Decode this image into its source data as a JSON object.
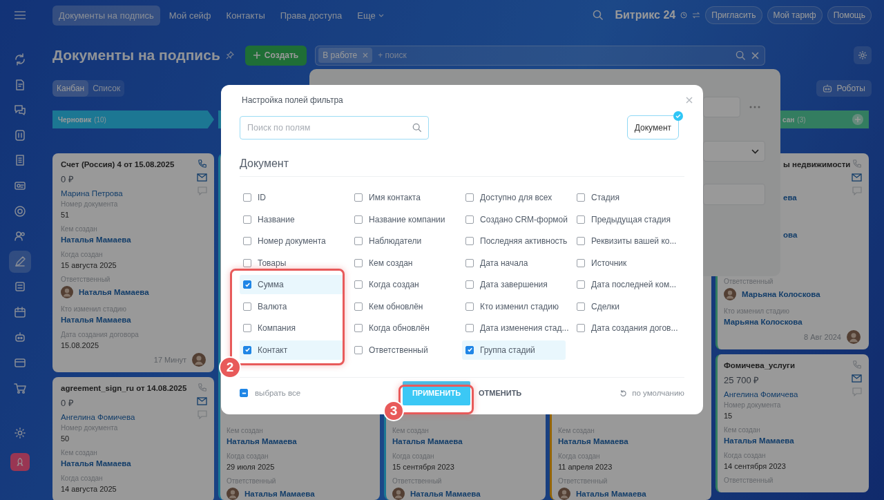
{
  "sidebar": {
    "items": [
      {
        "selected": false
      },
      {
        "selected": false
      },
      {
        "selected": false
      },
      {
        "selected": false
      },
      {
        "selected": false
      },
      {
        "selected": false
      },
      {
        "selected": false
      },
      {
        "selected": false
      },
      {
        "selected": true
      },
      {
        "selected": false
      },
      {
        "selected": false
      },
      {
        "selected": false
      },
      {
        "selected": false
      },
      {
        "selected": false
      }
    ]
  },
  "top_nav": {
    "tabs": [
      {
        "label": "Документы на подпись",
        "selected": true
      },
      {
        "label": "Мой сейф",
        "selected": false
      },
      {
        "label": "Контакты",
        "selected": false
      },
      {
        "label": "Права доступа",
        "selected": false
      },
      {
        "label": "Еще",
        "selected": false
      }
    ],
    "logo": "Битрикс 24",
    "buttons": [
      "Пригласить",
      "Мой тариф",
      "Помощь"
    ]
  },
  "header": {
    "title": "Документы на подпись",
    "create_button": "Создать",
    "filter": {
      "tag": "В работе",
      "placeholder": "+ поиск"
    }
  },
  "view_switch": [
    {
      "label": "Канбан",
      "selected": true
    },
    {
      "label": "Список",
      "selected": false
    }
  ],
  "robots_button": "Роботы",
  "columns": [
    {
      "title": "Черновик",
      "count": "(10)",
      "cut": false,
      "cards": [
        {
          "title": "Счет (Россия) 4 от 15.08.2025",
          "amount": "0 ₽",
          "client": "Марина Петрова",
          "phone_active": true,
          "fields": [
            {
              "label": "Номер документа",
              "value": "51",
              "kind": "text"
            },
            {
              "label": "Кем создан",
              "value": "Наталья Мамаева",
              "kind": "link"
            },
            {
              "label": "Когда создан",
              "value": "15 августа 2025",
              "kind": "text"
            },
            {
              "label": "Ответственный",
              "value": "Наталья Мамаева",
              "kind": "person"
            },
            {
              "label": "Кто изменил стадию",
              "value": "Наталья Мамаева",
              "kind": "link"
            },
            {
              "label": "Дата создания договора",
              "value": "15.08.2025",
              "kind": "text"
            }
          ],
          "time": "17 Минут"
        },
        {
          "title": "agreement_sign_ru от 14.08.2025",
          "amount": "0 ₽",
          "client": "Ангелина Фомичева",
          "phone_active": false,
          "fields": [
            {
              "label": "Номер документа",
              "value": "50",
              "kind": "text"
            },
            {
              "label": "Кем создан",
              "value": "Наталья Мамаева",
              "kind": "link"
            },
            {
              "label": "Когда создан",
              "value": "14 августа 2025",
              "kind": "text"
            }
          ]
        }
      ]
    },
    {
      "cards": [
        {
          "fields": [
            {
              "label": "Кем создан",
              "value": "Наталья Мамаева",
              "kind": "link"
            },
            {
              "label": "Когда создан",
              "value": "29 июля 2025",
              "kind": "text"
            },
            {
              "label": "Ответственный",
              "value": "Наталья Мамаева",
              "kind": "person"
            }
          ]
        }
      ]
    },
    {
      "cards": [
        {
          "fields": [
            {
              "label": "Кем создан",
              "value": "Наталья Мамаева",
              "kind": "link"
            },
            {
              "label": "Когда создан",
              "value": "15 сентября 2023",
              "kind": "text"
            },
            {
              "label": "Ответственный",
              "value": "Наталья Мамаева",
              "kind": "person"
            }
          ]
        }
      ]
    },
    {
      "cards": [
        {
          "fields": [
            {
              "label": "Кем создан",
              "value": "Наталья Мамаева",
              "kind": "link"
            },
            {
              "label": "Когда создан",
              "value": "11 апреля 2023",
              "kind": "text"
            },
            {
              "label": "Ответственный",
              "value": "Наталья Мамаева",
              "kind": "person"
            }
          ]
        }
      ]
    },
    {
      "title": "сан",
      "count": "(3)",
      "cut": true,
      "cards": [
        {
          "title": "ы недвижимости",
          "cut": true,
          "phone_active": false,
          "fields": [
            {
              "value": "ева",
              "kind": "link",
              "cut": true
            },
            {
              "value": "ова",
              "kind": "link",
              "cut": true
            },
            {
              "label": "Ответственный",
              "value": "Марьяна Колоскова",
              "kind": "person"
            },
            {
              "label": "Кто изменил стадию",
              "value": "Марьяна Колоскова",
              "kind": "link"
            }
          ],
          "time": "8 Авг 2024"
        },
        {
          "title": "Фомичева_услуги",
          "amount": "25 700 ₽",
          "client": "Ангелина Фомичева",
          "phone_active": false,
          "fields": [
            {
              "label": "Номер документа",
              "value": "15",
              "kind": "text"
            },
            {
              "label": "Кем создан",
              "value": "Наталья Мамаева",
              "kind": "link"
            },
            {
              "label": "Когда создан",
              "value": "14 сентября 2023",
              "kind": "text"
            },
            {
              "label": "Ответственный",
              "kind": "label"
            }
          ]
        }
      ]
    }
  ],
  "filter_settings": {
    "title": "Настройка полей фильтра",
    "search_placeholder": "Поиск по полям",
    "entity_button": {
      "label": "Документ",
      "selected": true
    },
    "section": "Документ",
    "field_columns": [
      [
        {
          "label": "ID",
          "checked": false
        },
        {
          "label": "Название",
          "checked": false
        },
        {
          "label": "Номер документа",
          "checked": false
        },
        {
          "label": "Товары",
          "checked": false
        },
        {
          "label": "Сумма",
          "checked": true
        },
        {
          "label": "Валюта",
          "checked": false
        },
        {
          "label": "Компания",
          "checked": false
        },
        {
          "label": "Контакт",
          "checked": true
        }
      ],
      [
        {
          "label": "Имя контакта",
          "checked": false
        },
        {
          "label": "Название компании",
          "checked": false
        },
        {
          "label": "Наблюдатели",
          "checked": false
        },
        {
          "label": "Кем создан",
          "checked": false
        },
        {
          "label": "Когда создан",
          "checked": false
        },
        {
          "label": "Кем обновлён",
          "checked": false
        },
        {
          "label": "Когда обновлён",
          "checked": false
        },
        {
          "label": "Ответственный",
          "checked": false
        }
      ],
      [
        {
          "label": "Доступно для всех",
          "checked": false
        },
        {
          "label": "Создано CRM-формой",
          "checked": false
        },
        {
          "label": "Последняя активность",
          "checked": false
        },
        {
          "label": "Дата начала",
          "checked": false
        },
        {
          "label": "Дата завершения",
          "checked": false
        },
        {
          "label": "Кто изменил стадию",
          "checked": false
        },
        {
          "label": "Дата изменения стад...",
          "checked": false
        },
        {
          "label": "Группа стадий",
          "checked": true
        }
      ],
      [
        {
          "label": "Стадия",
          "checked": false
        },
        {
          "label": "Предыдущая стадия",
          "checked": false
        },
        {
          "label": "Реквизиты вашей ко...",
          "checked": false
        },
        {
          "label": "Источник",
          "checked": false
        },
        {
          "label": "Дата последней ком...",
          "checked": false
        },
        {
          "label": "Сделки",
          "checked": false
        },
        {
          "label": "Дата создания догов...",
          "checked": false
        }
      ]
    ],
    "select_all": {
      "label": "выбрать все",
      "partial": true
    },
    "apply_button": "ПРИМЕНИТЬ",
    "cancel_button": "ОТМЕНИТЬ",
    "default_button": "по умолчанию"
  },
  "callouts": [
    {
      "label": "2"
    },
    {
      "label": "3"
    }
  ]
}
